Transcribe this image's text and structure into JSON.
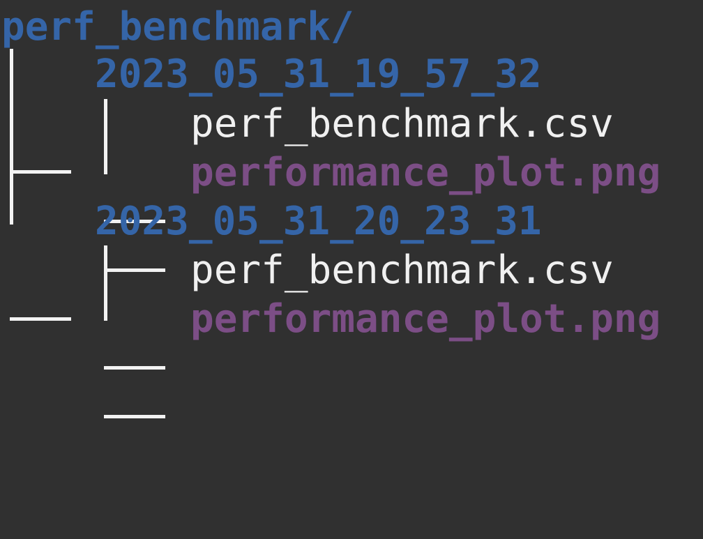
{
  "colors": {
    "background": "#303030",
    "directory": "#3565a8",
    "file": "#f0f0f0",
    "image_file": "#7c4e86"
  },
  "tree": {
    "root": "perf_benchmark/",
    "children": [
      {
        "name": "2023_05_31_19_57_32",
        "files": [
          {
            "name": "perf_benchmark.csv"
          },
          {
            "name": "performance_plot.png"
          }
        ]
      },
      {
        "name": "2023_05_31_20_23_31",
        "files": [
          {
            "name": "perf_benchmark.csv"
          },
          {
            "name": "performance_plot.png"
          }
        ]
      }
    ]
  }
}
